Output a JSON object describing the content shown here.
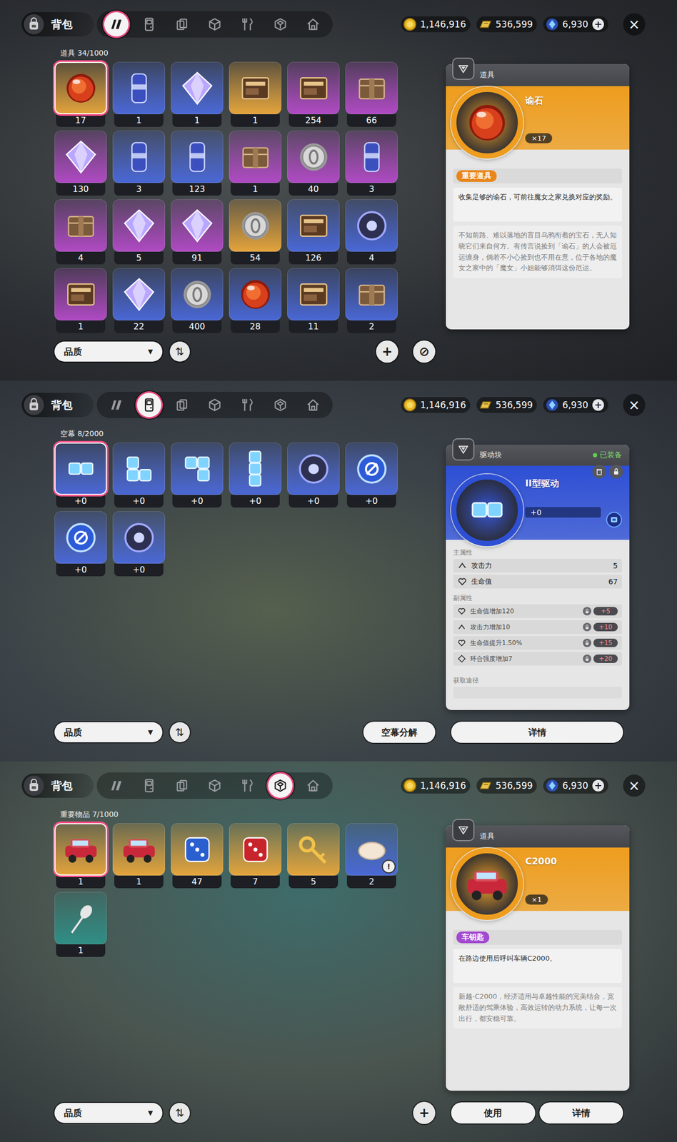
{
  "screens": [
    {
      "header": {
        "title": "背包",
        "tabs": [
          {
            "selected": true
          },
          {
            "selected": false
          },
          {
            "selected": false
          },
          {
            "selected": false
          },
          {
            "selected": false
          },
          {
            "selected": false
          },
          {
            "selected": false
          }
        ],
        "currencies": [
          "1,146,916",
          "536,599",
          "6,930"
        ],
        "add": "+",
        "close": "×"
      },
      "grid": {
        "label": "道具 34/1000",
        "items": [
          {
            "count": "17",
            "color": "#e4a43c",
            "selected": true
          },
          {
            "count": "1",
            "color": "#4a68d6",
            "selected": false
          },
          {
            "count": "1",
            "color": "#4a68d6",
            "selected": false
          },
          {
            "count": "1",
            "color": "#e4a43c",
            "selected": false
          },
          {
            "count": "254",
            "color": "#b04ac4",
            "selected": false
          },
          {
            "count": "66",
            "color": "#b04ac4",
            "selected": false
          },
          {
            "count": "130",
            "color": "#b04ac4",
            "selected": false
          },
          {
            "count": "3",
            "color": "#4a68d6",
            "selected": false
          },
          {
            "count": "123",
            "color": "#4a68d6",
            "selected": false
          },
          {
            "count": "1",
            "color": "#b04ac4",
            "selected": false
          },
          {
            "count": "40",
            "color": "#b04ac4",
            "selected": false
          },
          {
            "count": "3",
            "color": "#b04ac4",
            "selected": false
          },
          {
            "count": "4",
            "color": "#b04ac4",
            "selected": false
          },
          {
            "count": "5",
            "color": "#b04ac4",
            "selected": false
          },
          {
            "count": "91",
            "color": "#b04ac4",
            "selected": false
          },
          {
            "count": "54",
            "color": "#e4a43c",
            "selected": false
          },
          {
            "count": "126",
            "color": "#4a68d6",
            "selected": false
          },
          {
            "count": "4",
            "color": "#4a68d6",
            "selected": false
          },
          {
            "count": "1",
            "color": "#b04ac4",
            "selected": false
          },
          {
            "count": "22",
            "color": "#4a68d6",
            "selected": false
          },
          {
            "count": "400",
            "color": "#4a68d6",
            "selected": false
          },
          {
            "count": "28",
            "color": "#4a68d6",
            "selected": false
          },
          {
            "count": "11",
            "color": "#4a68d6",
            "selected": false
          },
          {
            "count": "2",
            "color": "#4a68d6",
            "selected": false
          }
        ]
      },
      "detail": {
        "kind": "item",
        "header": "道具",
        "name": "谕石",
        "count": "×17",
        "color": "#ee9d1e",
        "tag": {
          "text": "重要道具",
          "color": "#e8861a"
        },
        "description": "收集足够的谕石，可前往魔女之家兑换对应的奖励。",
        "lore": "不知前路、难以落地的盲目乌鸦衔着的宝石，无人知晓它们来自何方。有传言说捡到「谕石」的人会被厄运缠身，倘若不小心捡到也不用在意，位于各地的魔女之家中的「魔女」小姐能够消弭这份厄运。"
      },
      "footer": {
        "filter": "品质",
        "filter_arrow": "▼",
        "sort": "⇅",
        "round_buttons": [
          "+",
          "⊘"
        ],
        "mid_buttons": [],
        "panel_buttons": []
      }
    },
    {
      "header": {
        "title": "背包",
        "tabs": [
          {
            "selected": false
          },
          {
            "selected": true
          },
          {
            "selected": false
          },
          {
            "selected": false
          },
          {
            "selected": false
          },
          {
            "selected": false
          },
          {
            "selected": false
          }
        ],
        "currencies": [
          "1,146,916",
          "536,599",
          "6,930"
        ],
        "add": "+",
        "close": "×"
      },
      "grid": {
        "label": "空幕 8/2000",
        "items": [
          {
            "count": "+0",
            "color": "#4a68d6",
            "selected": true
          },
          {
            "count": "+0",
            "color": "#4a68d6",
            "selected": false
          },
          {
            "count": "+0",
            "color": "#4a68d6",
            "selected": false
          },
          {
            "count": "+0",
            "color": "#4a68d6",
            "selected": false
          },
          {
            "count": "+0",
            "color": "#4a68d6",
            "selected": false
          },
          {
            "count": "+0",
            "color": "#4a68d6",
            "selected": false
          },
          {
            "count": "+0",
            "color": "#4a68d6",
            "selected": false
          },
          {
            "count": "+0",
            "color": "#4a68d6",
            "selected": false
          }
        ]
      },
      "detail": {
        "kind": "disk",
        "header": "驱动块",
        "equipped": "已装备",
        "name": "II型驱动",
        "level": "+0",
        "color": "#2d4fd4",
        "main_heading": "主属性",
        "main_stats": [
          {
            "kind": "atk",
            "name": "攻击力",
            "value": "5"
          },
          {
            "kind": "hp",
            "name": "生命值",
            "value": "67"
          }
        ],
        "sub_heading": "副属性",
        "sub_stats": [
          {
            "kind": "hp",
            "name": "生命值增加120",
            "value": "+5",
            "locked": true
          },
          {
            "kind": "atk",
            "name": "攻击力增加10",
            "value": "+10",
            "locked": true
          },
          {
            "kind": "hp",
            "name": "生命值提升1.50%",
            "value": "+15",
            "locked": true
          },
          {
            "kind": "pen",
            "name": "环合强度增加7",
            "value": "+20",
            "locked": true
          }
        ],
        "source_heading": "获取途径"
      },
      "footer": {
        "filter": "品质",
        "filter_arrow": "▼",
        "sort": "⇅",
        "round_buttons": [],
        "mid_buttons": [
          "空幕分解"
        ],
        "panel_buttons": [
          "详情"
        ]
      }
    },
    {
      "header": {
        "title": "背包",
        "tabs": [
          {
            "selected": false
          },
          {
            "selected": false
          },
          {
            "selected": false
          },
          {
            "selected": false
          },
          {
            "selected": false
          },
          {
            "selected": true
          },
          {
            "selected": false
          }
        ],
        "currencies": [
          "1,146,916",
          "536,599",
          "6,930"
        ],
        "add": "+",
        "close": "×"
      },
      "grid": {
        "label": "重要物品 7/1000",
        "items": [
          {
            "count": "1",
            "color": "#e4a43c",
            "selected": true
          },
          {
            "count": "1",
            "color": "#e4a43c",
            "selected": false
          },
          {
            "count": "47",
            "color": "#e4a43c",
            "selected": false
          },
          {
            "count": "7",
            "color": "#e4a43c",
            "selected": false
          },
          {
            "count": "5",
            "color": "#e4a43c",
            "selected": false
          },
          {
            "count": "2",
            "color": "#4a68d6",
            "selected": false,
            "badge": "!"
          },
          {
            "count": "1",
            "color": "#2f8f86",
            "selected": false
          }
        ]
      },
      "detail": {
        "kind": "item",
        "header": "道具",
        "name": "C2000",
        "count": "×1",
        "color": "#ee9d1e",
        "tag": {
          "text": "车钥匙",
          "color": "#a24ad0"
        },
        "description": "在路边使用后呼叫车辆C2000。",
        "lore": "新越-C2000，经济适用与卓越性能的完美结合，宽敞舒适的驾乘体验，高效运转的动力系统，让每一次出行，都安稳可靠。"
      },
      "footer": {
        "filter": "品质",
        "filter_arrow": "▼",
        "sort": "⇅",
        "round_buttons": [
          "+"
        ],
        "mid_buttons": [],
        "panel_buttons": [
          "使用",
          "详情"
        ]
      }
    }
  ]
}
